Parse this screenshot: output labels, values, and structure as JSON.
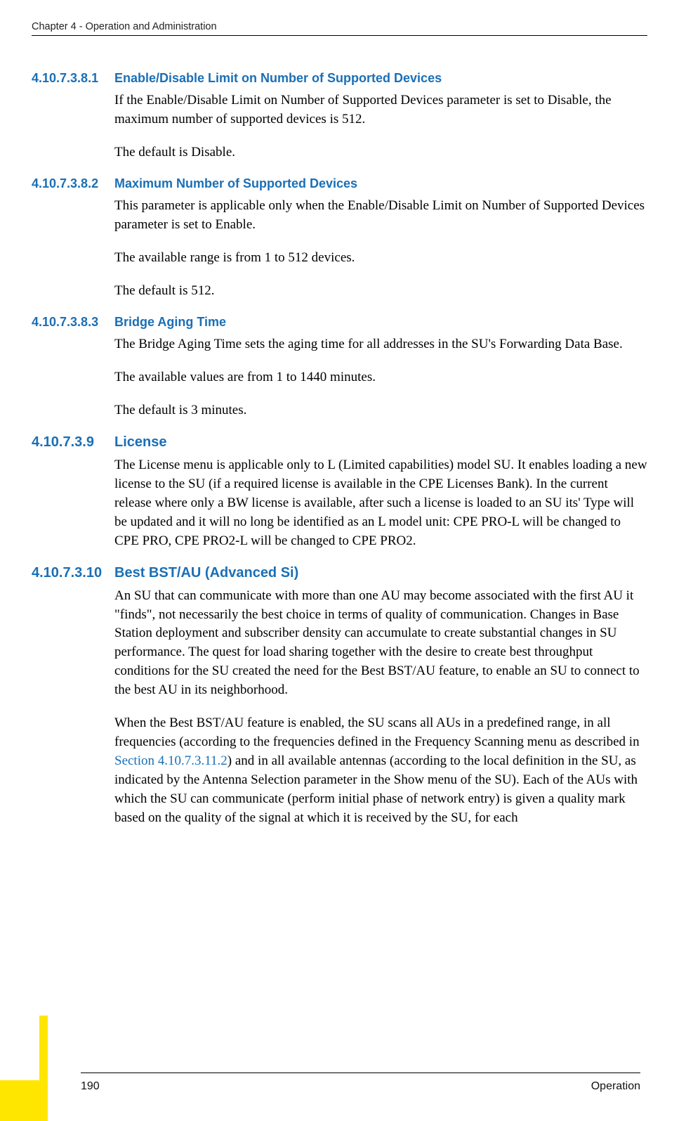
{
  "runningHead": "Chapter 4 - Operation and Administration",
  "sections": [
    {
      "num": "4.10.7.3.8.1",
      "title": "Enable/Disable Limit on Number of Supported Devices",
      "paras": [
        "If the Enable/Disable Limit on Number of Supported Devices parameter is set to Disable, the maximum number of supported devices is 512.",
        "The default is Disable."
      ]
    },
    {
      "num": "4.10.7.3.8.2",
      "title": "Maximum Number of Supported Devices",
      "paras": [
        "This parameter is applicable only when the Enable/Disable Limit on Number of Supported Devices parameter is set to Enable.",
        "The available range is from 1 to 512 devices.",
        "The default is 512."
      ]
    },
    {
      "num": "4.10.7.3.8.3",
      "title": "Bridge Aging Time",
      "paras": [
        "The Bridge Aging Time sets the aging time for all addresses in the SU's Forwarding Data Base.",
        "The available values are from 1 to 1440 minutes.",
        "The default is 3 minutes."
      ]
    },
    {
      "num": "4.10.7.3.9",
      "title": "License",
      "paras": [
        "The License menu is applicable only to L (Limited capabilities) model SU. It enables loading a new license to the SU (if a required license is available in the CPE Licenses Bank). In the current release where only a BW license is available, after such a license is loaded to an SU its' Type will be updated and it will no long be identified as an L model unit: CPE PRO-L will be changed to CPE PRO, CPE PRO2-L will be changed to CPE PRO2."
      ]
    },
    {
      "num": "4.10.7.3.10",
      "title": "Best BST/AU (Advanced Si)",
      "paras": [
        "An SU that can communicate with more than one AU may become associated with the first AU it \"finds\", not necessarily the best choice in terms of quality of communication. Changes in Base Station deployment and subscriber density can accumulate to create substantial changes in SU performance. The quest for load sharing together with the desire to create best throughput conditions for the SU created the need for the Best BST/AU feature, to enable an SU to connect to the best AU in its neighborhood."
      ],
      "special_para": {
        "pre": "When the Best BST/AU feature is enabled, the SU scans all AUs in a predefined range, in all frequencies (according to the frequencies defined in the Frequency Scanning menu as described in ",
        "link": "Section 4.10.7.3.11.2",
        "post": ") and in all available antennas (according to the local definition in the SU, as indicated by the Antenna Selection parameter in the Show menu of the SU). Each of the AUs with which the SU can communicate (perform initial phase of network entry) is given a quality mark based on the quality of the signal at which it is received by the SU, for each"
      }
    }
  ],
  "footer": {
    "pageNum": "190",
    "rightText": "Operation"
  }
}
